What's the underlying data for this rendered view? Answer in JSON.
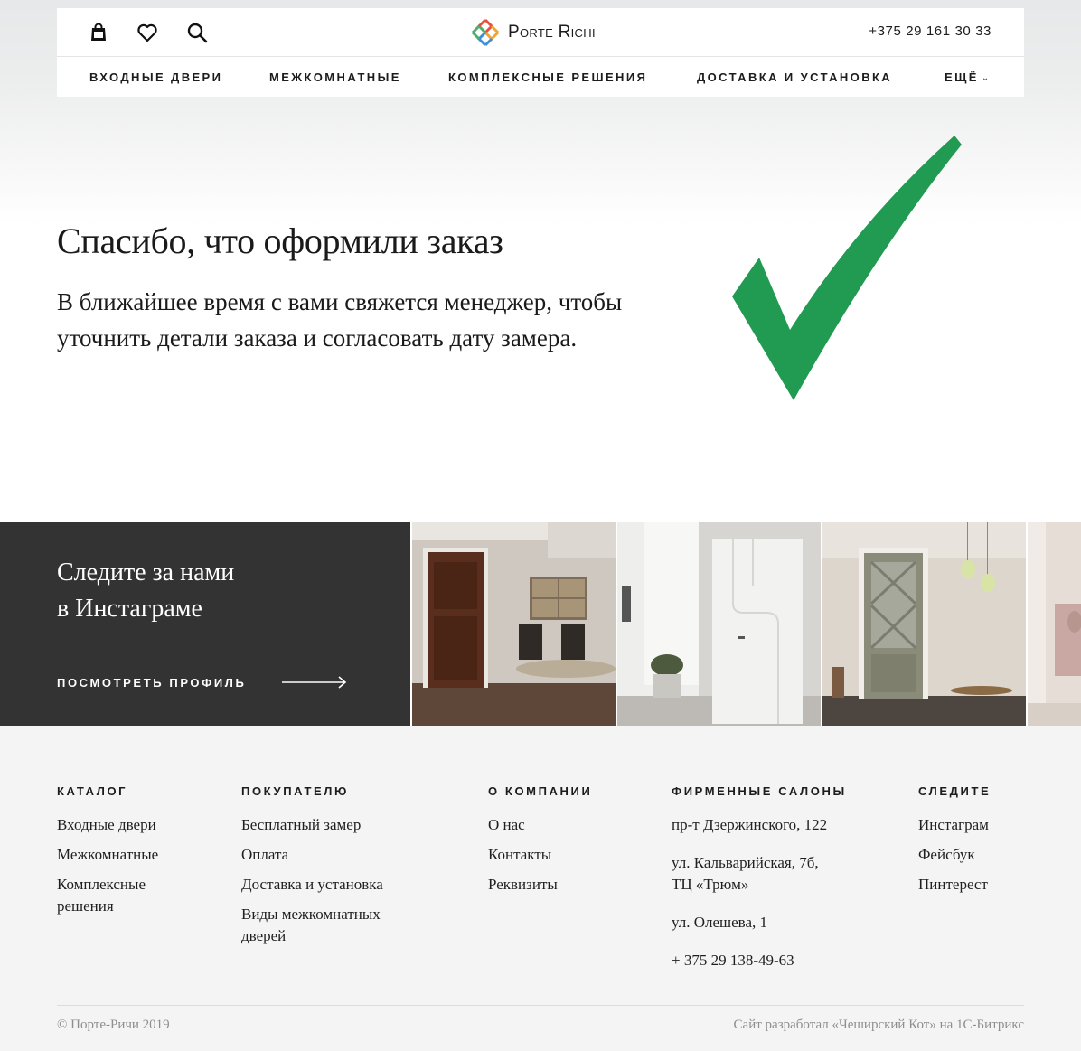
{
  "header": {
    "brand": "Porte Richi",
    "phone": "+375 29 161 30 33",
    "icons": [
      "bag-icon",
      "heart-icon",
      "search-icon"
    ]
  },
  "nav": {
    "items": [
      {
        "label": "ВХОДНЫЕ ДВЕРИ"
      },
      {
        "label": "МЕЖКОМНАТНЫЕ"
      },
      {
        "label": "КОМПЛЕКСНЫЕ РЕШЕНИЯ"
      },
      {
        "label": "ДОСТАВКА И УСТАНОВКА"
      },
      {
        "label": "ЕЩЁ"
      }
    ]
  },
  "hero": {
    "title": "Спасибо, что оформили заказ",
    "text": "В ближайшее время с вами свяжется менеджер, чтобы уточнить детали заказа и согласовать дату замера.",
    "check_color": "#219a52"
  },
  "instagram": {
    "title_line1": "Следите за нами",
    "title_line2": "в Инстаграме",
    "link": "ПОСМОТРЕТЬ ПРОФИЛЬ",
    "panel_color": "#333333"
  },
  "footer": {
    "catalog": {
      "heading": "КАТАЛОГ",
      "links": [
        "Входные двери",
        "Межкомнатные",
        "Комплексные решения"
      ]
    },
    "buyer": {
      "heading": "ПОКУПАТЕЛЮ",
      "links": [
        "Бесплатный замер",
        "Оплата",
        "Доставка и установка",
        "Виды межкомнатных дверей"
      ]
    },
    "company": {
      "heading": "О КОМПАНИИ",
      "links": [
        "О нас",
        "Контакты",
        "Реквизиты"
      ]
    },
    "salons": {
      "heading": "ФИРМЕННЫЕ САЛОНЫ",
      "addresses": [
        "пр-т Дзержинского, 122",
        "ул. Кальварийская, 7б, ТЦ «Трюм»",
        "ул. Олешева, 1",
        "+ 375 29 138-49-63"
      ]
    },
    "follow": {
      "heading": "СЛЕДИТЕ",
      "links": [
        "Инстаграм",
        "Фейсбук",
        "Пинтерест"
      ]
    },
    "copyright": "© Порте-Ричи 2019",
    "credit": "Сайт разработал «Чеширский Кот» на 1С-Битрикс"
  }
}
